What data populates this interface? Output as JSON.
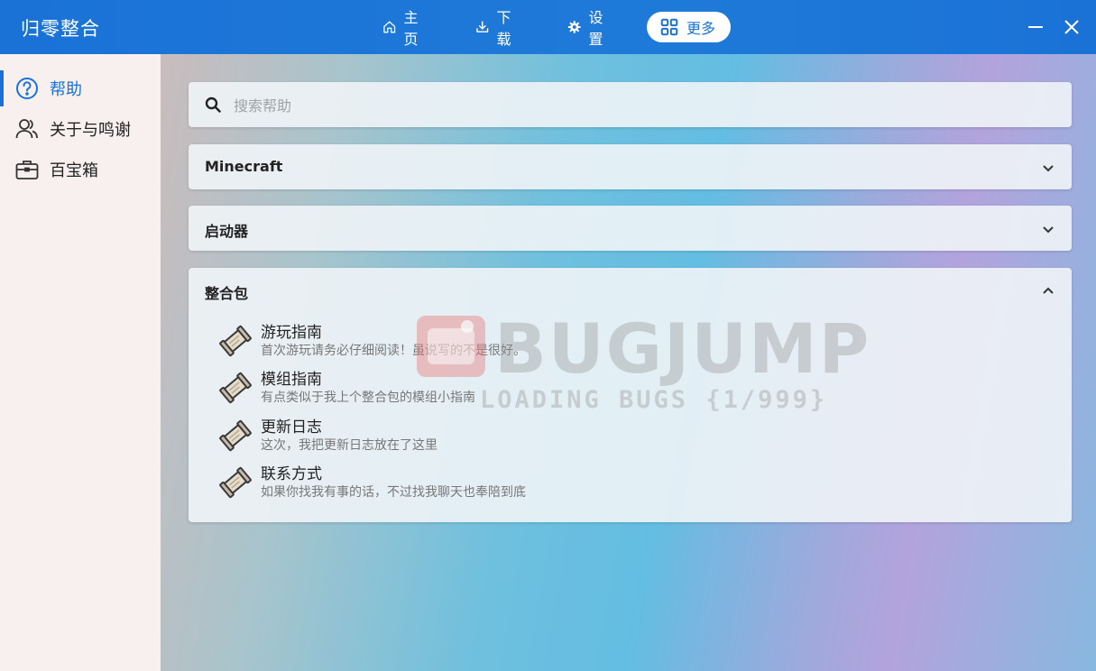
{
  "app": {
    "title": "归零整合"
  },
  "nav": {
    "items": [
      {
        "label": "主页",
        "icon": "home-icon"
      },
      {
        "label": "下载",
        "icon": "download-icon"
      },
      {
        "label": "设置",
        "icon": "gear-icon"
      },
      {
        "label": "更多",
        "icon": "grid-icon",
        "active": true
      }
    ]
  },
  "sidebar": {
    "items": [
      {
        "label": "帮助",
        "icon": "help-icon",
        "active": true
      },
      {
        "label": "关于与鸣谢",
        "icon": "people-icon"
      },
      {
        "label": "百宝箱",
        "icon": "toolbox-icon"
      }
    ]
  },
  "search": {
    "placeholder": "搜索帮助"
  },
  "sections": [
    {
      "title": "Minecraft",
      "expanded": false
    },
    {
      "title": "启动器",
      "expanded": false
    },
    {
      "title": "整合包",
      "expanded": true,
      "entries": [
        {
          "title": "游玩指南",
          "desc": "首次游玩请务必仔细阅读！虽说写的不是很好。"
        },
        {
          "title": "模组指南",
          "desc": "有点类似于我上个整合包的模组小指南"
        },
        {
          "title": "更新日志",
          "desc": "这次，我把更新日志放在了这里"
        },
        {
          "title": "联系方式",
          "desc": "如果你找我有事的话，不过找我聊天也奉陪到底"
        }
      ]
    }
  ],
  "watermark": {
    "text": "BUGJUMP",
    "sub": "LOADING BUGS {1/999}"
  },
  "colors": {
    "accent": "#1a72d6"
  }
}
